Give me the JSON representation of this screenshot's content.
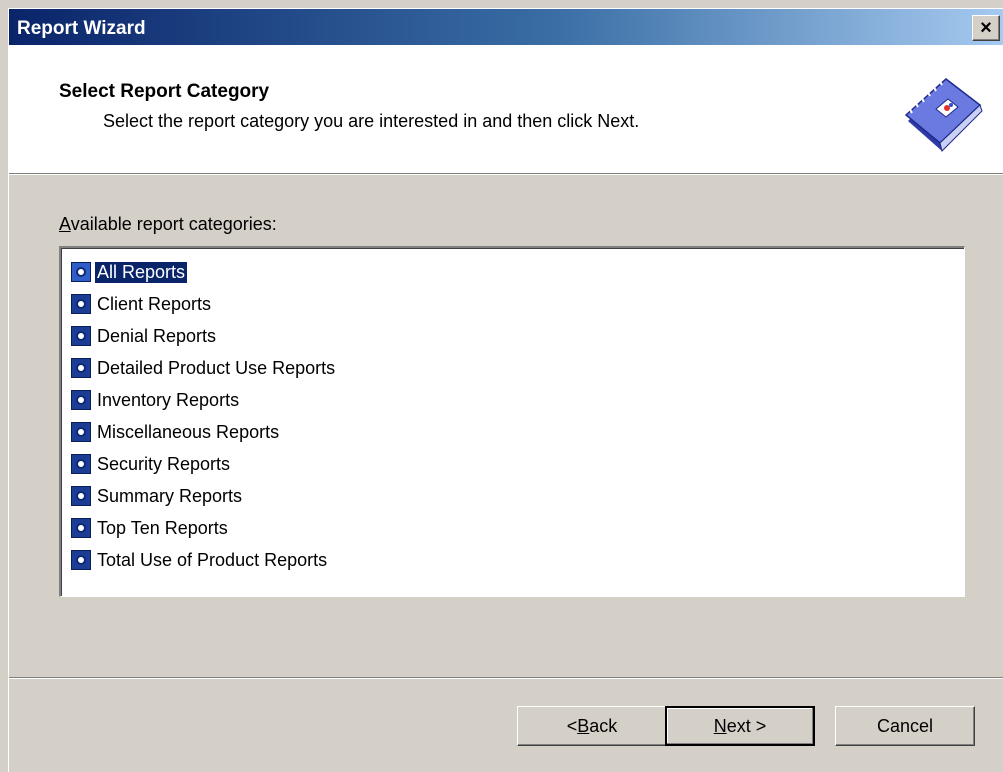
{
  "window": {
    "title": "Report Wizard",
    "close_label": "×"
  },
  "header": {
    "title": "Select Report Category",
    "subtitle": "Select the report category you are interested in and then click Next.",
    "icon": "report-book-icon"
  },
  "list": {
    "label_prefix": "",
    "label_accel": "A",
    "label_rest": "vailable report categories:",
    "items": [
      {
        "label": "All Reports",
        "selected": true
      },
      {
        "label": "Client Reports",
        "selected": false
      },
      {
        "label": "Denial Reports",
        "selected": false
      },
      {
        "label": "Detailed Product Use Reports",
        "selected": false
      },
      {
        "label": "Inventory Reports",
        "selected": false
      },
      {
        "label": "Miscellaneous Reports",
        "selected": false
      },
      {
        "label": "Security Reports",
        "selected": false
      },
      {
        "label": "Summary Reports",
        "selected": false
      },
      {
        "label": "Top Ten Reports",
        "selected": false
      },
      {
        "label": "Total Use of Product Reports",
        "selected": false
      }
    ]
  },
  "buttons": {
    "back_prefix": "< ",
    "back_accel": "B",
    "back_rest": "ack",
    "next_accel": "N",
    "next_rest": "ext >",
    "cancel": "Cancel"
  },
  "colors": {
    "titlebar_start": "#0a246a",
    "titlebar_end": "#a6caf0",
    "face": "#d4d0c8",
    "selection": "#0a246a"
  }
}
